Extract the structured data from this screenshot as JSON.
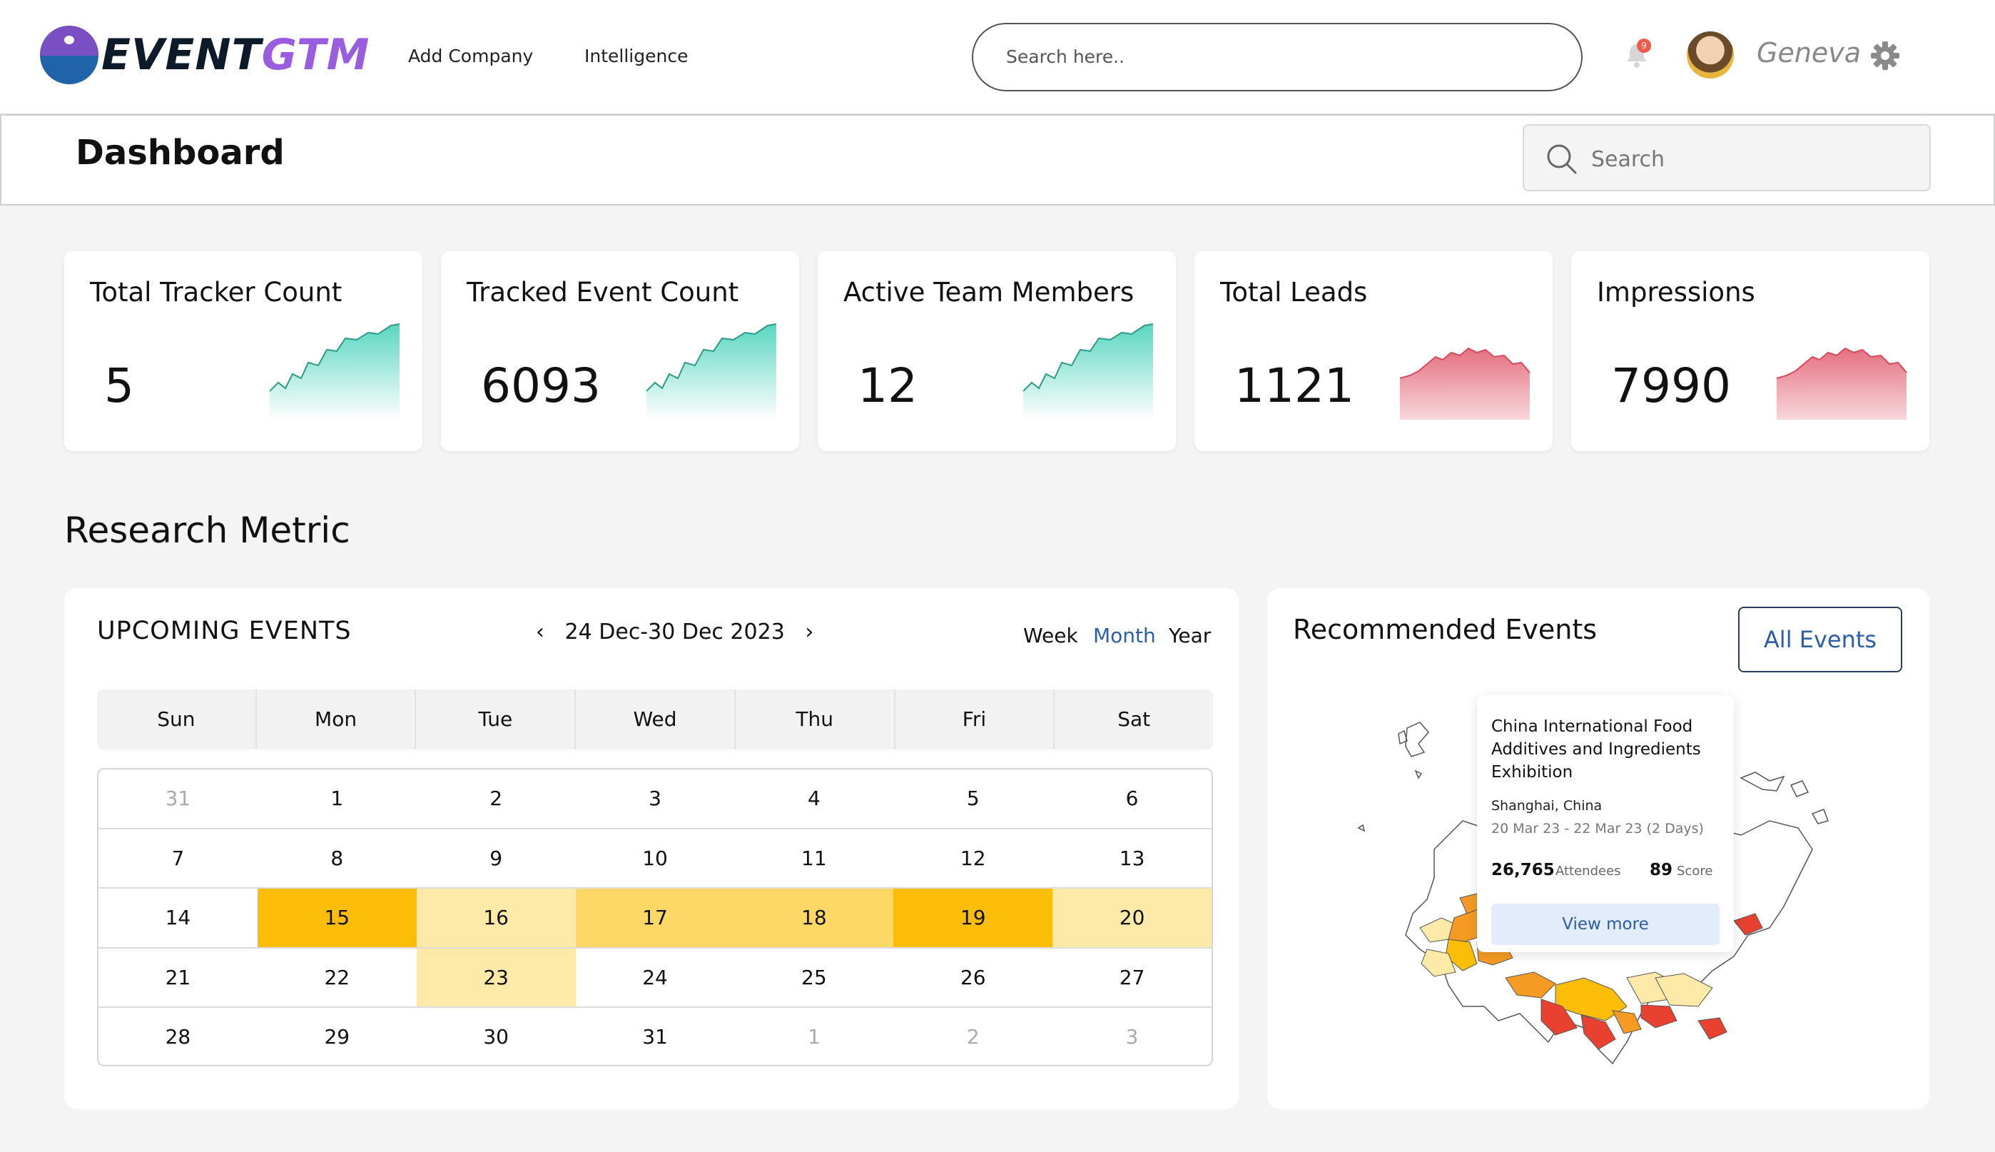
{
  "header": {
    "logo_event": "EVENT",
    "logo_gtm": "GTM",
    "nav": [
      "Add Company",
      "Intelligence"
    ],
    "search_placeholder": "Search here..",
    "notification_count": "9",
    "user_name": "Geneva"
  },
  "subheader": {
    "title": "Dashboard",
    "search_placeholder": "Search"
  },
  "stats": [
    {
      "label": "Total Tracker Count",
      "value": "5",
      "trend": "up"
    },
    {
      "label": "Tracked Event Count",
      "value": "6093",
      "trend": "up"
    },
    {
      "label": "Active Team Members",
      "value": "12",
      "trend": "up"
    },
    {
      "label": "Total Leads",
      "value": "1121",
      "trend": "down"
    },
    {
      "label": "Impressions",
      "value": "7990",
      "trend": "down"
    }
  ],
  "section_title": "Research Metric",
  "upcoming": {
    "title": "UPCOMING EVENTS",
    "date_range": "24 Dec-30 Dec 2023",
    "toggles": [
      "Week",
      "Month",
      "Year"
    ],
    "active_toggle": "Month",
    "weekdays": [
      "Sun",
      "Mon",
      "Tue",
      "Wed",
      "Thu",
      "Fri",
      "Sat"
    ],
    "weeks": [
      [
        "31",
        "1",
        "2",
        "3",
        "4",
        "5",
        "6"
      ],
      [
        "7",
        "8",
        "9",
        "10",
        "11",
        "12",
        "13"
      ],
      [
        "14",
        "15",
        "16",
        "17",
        "18",
        "19",
        "20"
      ],
      [
        "21",
        "22",
        "23",
        "24",
        "25",
        "26",
        "27"
      ],
      [
        "28",
        "29",
        "30",
        "31",
        "1",
        "2",
        "3"
      ]
    ]
  },
  "recommended": {
    "title": "Recommended Events",
    "all_button": "All Events",
    "tooltip": {
      "name": "China International Food Additives and Ingredients Exhibition",
      "location": "Shanghai, China",
      "dates": "20 Mar 23 - 22 Mar 23 (2 Days)",
      "attendees": "26,765",
      "attendees_label": "Attendees",
      "score": "89",
      "score_label": "Score",
      "cta": "View more"
    }
  },
  "colors": {
    "up_trend": "#5ad6c0",
    "down_trend": "#e4707f",
    "highlight_strong": "#fbbd08",
    "highlight_medium": "#fdd866",
    "highlight_light": "#fde9a8",
    "accent_link": "#2c5ea8"
  }
}
